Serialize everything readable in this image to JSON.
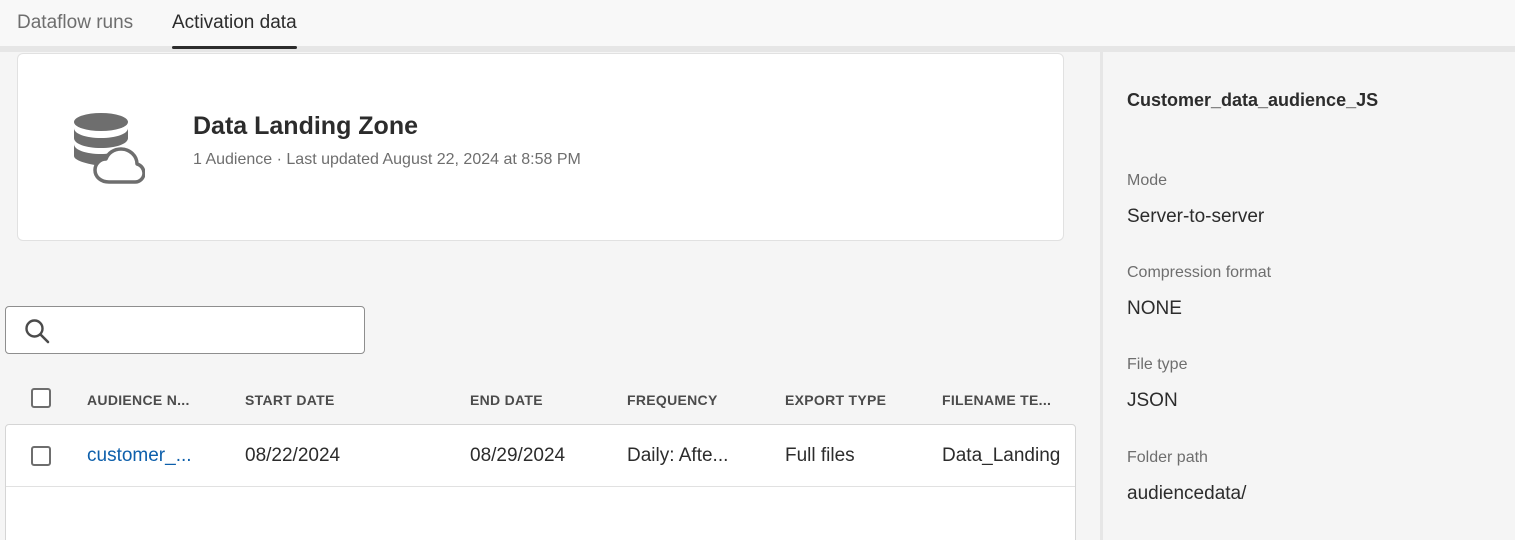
{
  "tabs": [
    {
      "label": "Dataflow runs",
      "active": false
    },
    {
      "label": "Activation data",
      "active": true
    }
  ],
  "destination": {
    "name": "Data Landing Zone",
    "meta": "1 Audience · Last updated August 22, 2024 at 8:58 PM",
    "icon": "database-cloud-icon"
  },
  "search": {
    "value": "",
    "placeholder": ""
  },
  "table": {
    "headers": [
      "AUDIENCE N...",
      "START DATE",
      "END DATE",
      "FREQUENCY",
      "EXPORT TYPE",
      "FILENAME TE..."
    ],
    "rows": [
      {
        "audience": "customer_...",
        "start_date": "08/22/2024",
        "end_date": "08/29/2024",
        "frequency": "Daily: Afte...",
        "export_type": "Full files",
        "filename": "Data_Landing"
      }
    ]
  },
  "panel": {
    "title": "Customer_data_audience_JS",
    "fields": [
      {
        "label": "Mode",
        "value": "Server-to-server"
      },
      {
        "label": "Compression format",
        "value": "NONE"
      },
      {
        "label": "File type",
        "value": "JSON"
      },
      {
        "label": "Folder path",
        "value": "audiencedata/"
      }
    ]
  },
  "colors": {
    "link": "#0d5fab",
    "text": "#2c2c2c",
    "muted": "#6e6e6e",
    "icon": "#6e6e6e"
  }
}
